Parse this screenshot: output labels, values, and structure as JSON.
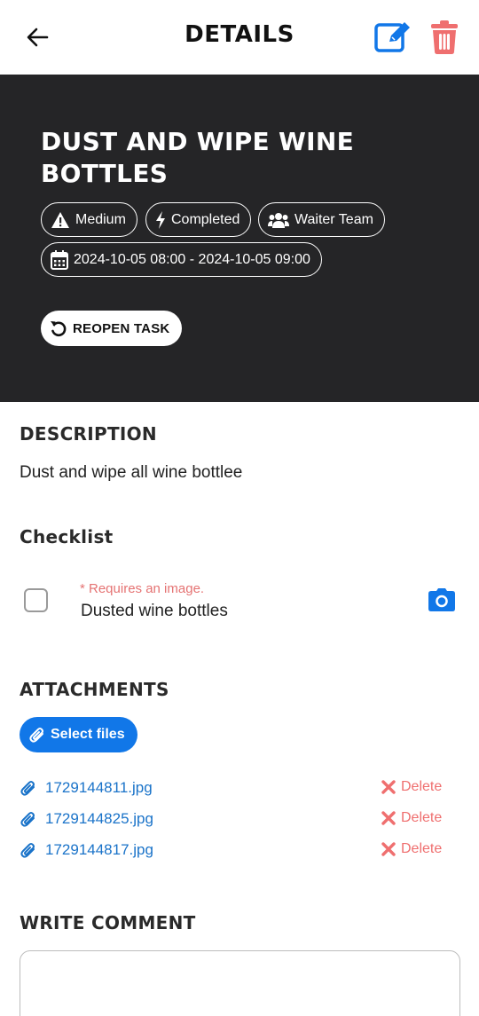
{
  "header": {
    "title": "DETAILS"
  },
  "task": {
    "title": "DUST AND WIPE WINE BOTTLES",
    "priority": "Medium",
    "status": "Completed",
    "team": "Waiter Team",
    "date_range": "2024-10-05 08:00 - 2024-10-05 09:00",
    "reopen_label": "REOPEN TASK"
  },
  "description": {
    "heading": "DESCRIPTION",
    "text": "Dust and wipe all wine bottlee"
  },
  "checklist": {
    "heading": "Checklist",
    "items": [
      {
        "note": "* Requires an image.",
        "label": "Dusted wine bottles",
        "checked": false
      }
    ]
  },
  "attachments": {
    "heading": "ATTACHMENTS",
    "select_label": "Select files",
    "delete_label": "Delete",
    "files": [
      {
        "name": "1729144811.jpg"
      },
      {
        "name": "1729144825.jpg"
      },
      {
        "name": "1729144817.jpg"
      }
    ]
  },
  "comment": {
    "heading": "WRITE COMMENT",
    "value": ""
  },
  "colors": {
    "hero_bg": "#252527",
    "accent_blue": "#1177e8",
    "danger_red": "#ef6f6f",
    "link_blue": "#1a73c9"
  },
  "icons": [
    "arrow-left-icon",
    "edit-icon",
    "trash-icon",
    "warning-icon",
    "bolt-icon",
    "users-icon",
    "calendar-icon",
    "undo-icon",
    "camera-icon",
    "paperclip-icon",
    "close-x-icon"
  ]
}
